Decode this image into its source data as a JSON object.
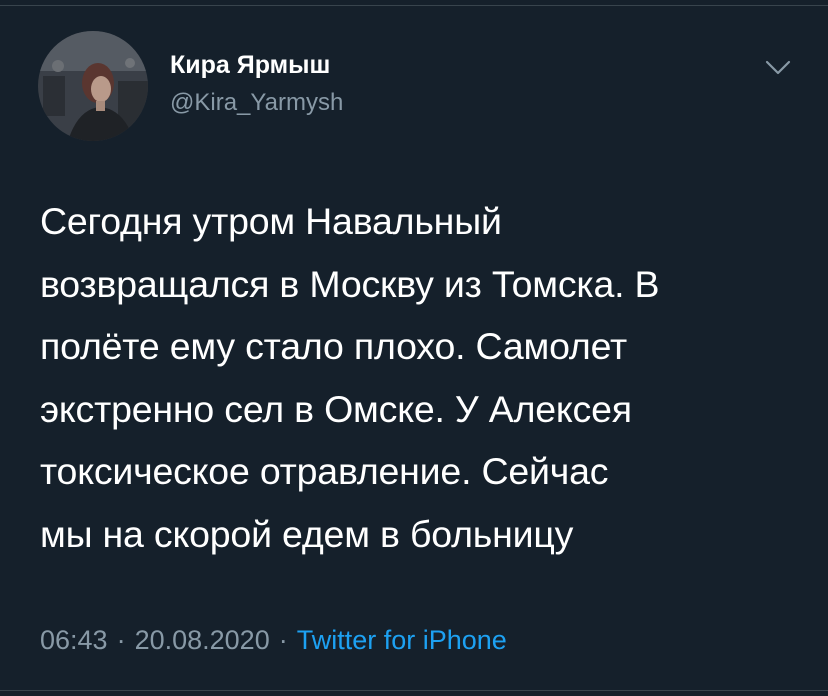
{
  "colors": {
    "background": "#15202b",
    "text_primary": "#ffffff",
    "text_secondary": "#8899a6",
    "link": "#1da1f2",
    "divider": "#38444d"
  },
  "author": {
    "display_name": "Кира Ярмыш",
    "handle": "@Kira_Yarmysh",
    "avatar_icon": "profile-photo"
  },
  "menu_icon": "chevron-down-icon",
  "tweet": {
    "text_lines": [
      "Сегодня утром Навальный",
      "возвращался в Москву из Томска. В",
      "полёте ему стало плохо. Самолет",
      "экстренно сел в Омске. У Алексея",
      "токсическое отравление. Сейчас",
      "мы на скорой едем в больницу"
    ]
  },
  "meta": {
    "time": "06:43",
    "date": "20.08.2020",
    "separator": "·",
    "source": "Twitter for iPhone"
  }
}
